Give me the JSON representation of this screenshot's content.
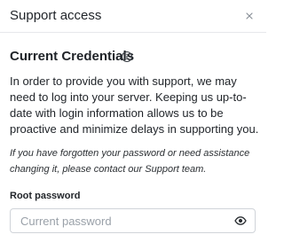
{
  "header": {
    "title": "Support access",
    "close_icon": "close-icon"
  },
  "section": {
    "title": "Current Credentials",
    "info_icon": "info-icon"
  },
  "description": "In order to provide you with support, we may need to log into your server. Keeping us up-to-date with login information allows us to be proactive and minimize delays in supporting you.",
  "note": "If you have forgotten your password or need assistance changing it, please contact our Support team.",
  "root_password": {
    "label": "Root password",
    "placeholder": "Current password",
    "value": "",
    "visibility_icon": "eye-icon"
  }
}
